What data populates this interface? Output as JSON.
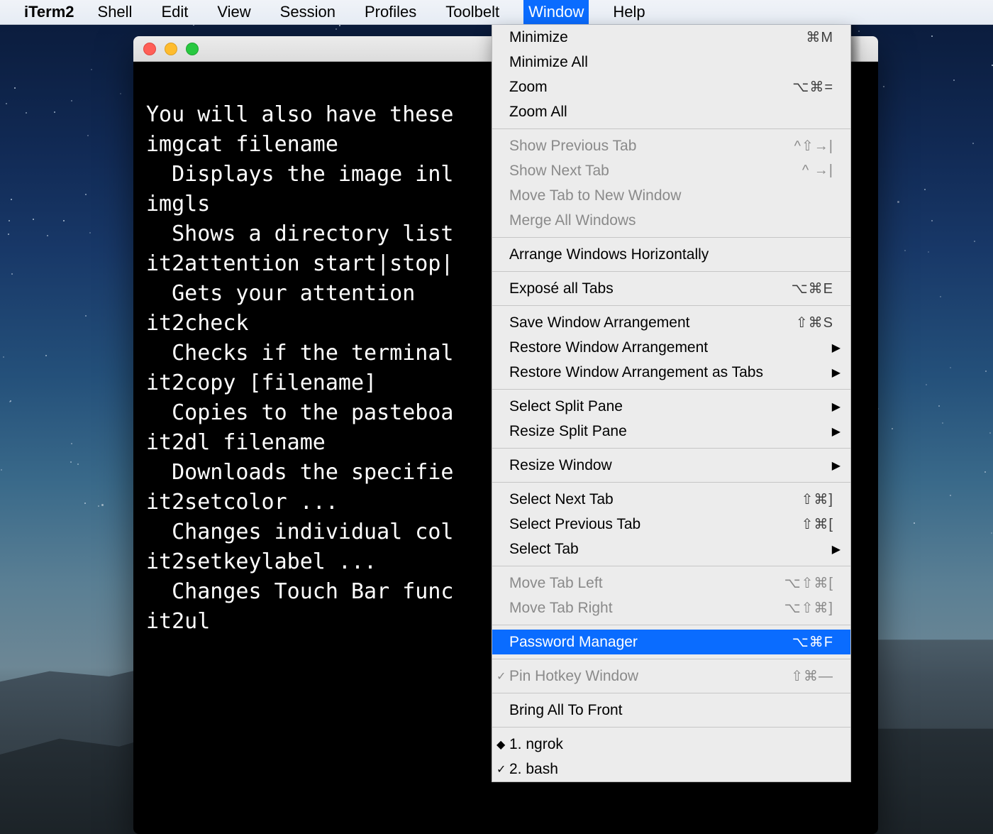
{
  "menubar": {
    "app": "iTerm2",
    "items": [
      "Shell",
      "Edit",
      "View",
      "Session",
      "Profiles",
      "Toolbelt",
      "Window",
      "Help"
    ],
    "open_index": 6
  },
  "terminal": {
    "lines": [
      "",
      "You will also have these",
      "imgcat filename",
      "  Displays the image inl",
      "imgls",
      "  Shows a directory list",
      "it2attention start|stop|",
      "  Gets your attention",
      "it2check",
      "  Checks if the terminal",
      "it2copy [filename]",
      "  Copies to the pasteboa",
      "it2dl filename",
      "  Downloads the specifie",
      "it2setcolor ...",
      "  Changes individual col",
      "it2setkeylabel ...",
      "  Changes Touch Bar func",
      "it2ul"
    ]
  },
  "dropdown": [
    {
      "label": "Minimize",
      "accel": "⌘M"
    },
    {
      "label": "Minimize All"
    },
    {
      "label": "Zoom",
      "accel": "⌥⌘="
    },
    {
      "label": "Zoom All"
    },
    {
      "sep": true
    },
    {
      "label": "Show Previous Tab",
      "accel": "^⇧→|",
      "disabled": true
    },
    {
      "label": "Show Next Tab",
      "accel": "^ →|",
      "disabled": true
    },
    {
      "label": "Move Tab to New Window",
      "disabled": true
    },
    {
      "label": "Merge All Windows",
      "disabled": true
    },
    {
      "sep": true
    },
    {
      "label": "Arrange Windows Horizontally"
    },
    {
      "sep": true
    },
    {
      "label": "Exposé all Tabs",
      "accel": "⌥⌘E"
    },
    {
      "sep": true
    },
    {
      "label": "Save Window Arrangement",
      "accel": "⇧⌘S"
    },
    {
      "label": "Restore Window Arrangement",
      "submenu": true
    },
    {
      "label": "Restore Window Arrangement as Tabs",
      "submenu": true
    },
    {
      "sep": true
    },
    {
      "label": "Select Split Pane",
      "submenu": true
    },
    {
      "label": "Resize Split Pane",
      "submenu": true
    },
    {
      "sep": true
    },
    {
      "label": "Resize Window",
      "submenu": true
    },
    {
      "sep": true
    },
    {
      "label": "Select Next Tab",
      "accel": "⇧⌘]"
    },
    {
      "label": "Select Previous Tab",
      "accel": "⇧⌘["
    },
    {
      "label": "Select Tab",
      "submenu": true
    },
    {
      "sep": true
    },
    {
      "label": "Move Tab Left",
      "accel": "⌥⇧⌘[",
      "disabled": true
    },
    {
      "label": "Move Tab Right",
      "accel": "⌥⇧⌘]",
      "disabled": true
    },
    {
      "sep": true
    },
    {
      "label": "Password Manager",
      "accel": "⌥⌘F",
      "selected": true
    },
    {
      "sep": true
    },
    {
      "label": "Pin Hotkey Window",
      "accel": "⇧⌘—",
      "disabled": true,
      "mark": "✓"
    },
    {
      "sep": true
    },
    {
      "label": "Bring All To Front"
    },
    {
      "sep": true
    },
    {
      "label": "1. ngrok",
      "mark": "◆"
    },
    {
      "label": "2. bash",
      "mark": "✓"
    }
  ]
}
